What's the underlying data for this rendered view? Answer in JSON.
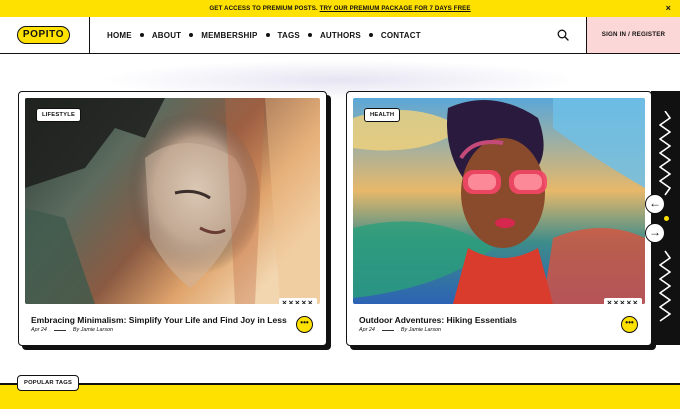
{
  "topbar": {
    "text": "GET ACCESS TO PREMIUM POSTS.",
    "link": "TRY OUR PREMIUM PACKAGE FOR 7 DAYS FREE",
    "close": "×"
  },
  "header": {
    "logo": "POPITO",
    "menu": [
      "HOME",
      "ABOUT",
      "MEMBERSHIP",
      "TAGS",
      "AUTHORS",
      "CONTACT"
    ],
    "signin": "SIGN IN / REGISTER"
  },
  "posts": [
    {
      "tag": "LIFESTYLE",
      "title": "Embracing Minimalism: Simplify Your Life and Find Joy in Less",
      "date": "Apr 24",
      "author": "By Jamie Larson",
      "marks": "✕✕✕✕✕"
    },
    {
      "tag": "HEALTH",
      "title": "Outdoor Adventures: Hiking Essentials",
      "date": "Apr 24",
      "author": "By Jamie Larson",
      "marks": "✕✕✕✕✕"
    }
  ],
  "carousel": {
    "prev": "←",
    "next": "→"
  },
  "sections": {
    "popular_tags": "POPULAR TAGS"
  },
  "colors": {
    "accent": "#ffe100",
    "signin_bg": "#fbd7d7",
    "ink": "#111111"
  },
  "icons": {
    "search": "search-icon",
    "more": "more-dots-icon"
  }
}
